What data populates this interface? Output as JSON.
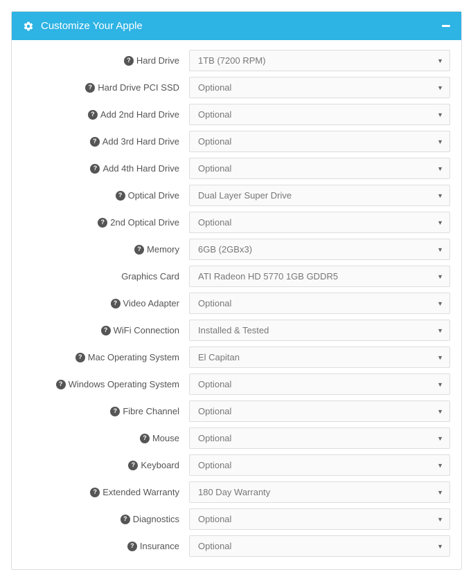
{
  "header": {
    "title": "Customize Your Apple"
  },
  "rows": [
    {
      "key": "hard-drive",
      "label": "Hard Drive",
      "value": "1TB (7200 RPM)",
      "help": true
    },
    {
      "key": "hard-drive-pci-ssd",
      "label": "Hard Drive PCI SSD",
      "value": "Optional",
      "help": true
    },
    {
      "key": "add-2nd-hard-drive",
      "label": "Add 2nd Hard Drive",
      "value": "Optional",
      "help": true
    },
    {
      "key": "add-3rd-hard-drive",
      "label": "Add 3rd Hard Drive",
      "value": "Optional",
      "help": true
    },
    {
      "key": "add-4th-hard-drive",
      "label": "Add 4th Hard Drive",
      "value": "Optional",
      "help": true
    },
    {
      "key": "optical-drive",
      "label": "Optical Drive",
      "value": "Dual Layer Super Drive",
      "help": true
    },
    {
      "key": "2nd-optical-drive",
      "label": "2nd Optical Drive",
      "value": "Optional",
      "help": true
    },
    {
      "key": "memory",
      "label": "Memory",
      "value": "6GB (2GBx3)",
      "help": true
    },
    {
      "key": "graphics-card",
      "label": "Graphics Card",
      "value": "ATI Radeon HD 5770 1GB GDDR5",
      "help": false
    },
    {
      "key": "video-adapter",
      "label": "Video Adapter",
      "value": "Optional",
      "help": true
    },
    {
      "key": "wifi-connection",
      "label": "WiFi Connection",
      "value": "Installed & Tested",
      "help": true
    },
    {
      "key": "mac-os",
      "label": "Mac Operating System",
      "value": "El Capitan",
      "help": true
    },
    {
      "key": "windows-os",
      "label": "Windows Operating System",
      "value": "Optional",
      "help": true
    },
    {
      "key": "fibre-channel",
      "label": "Fibre Channel",
      "value": "Optional",
      "help": true
    },
    {
      "key": "mouse",
      "label": "Mouse",
      "value": "Optional",
      "help": true
    },
    {
      "key": "keyboard",
      "label": "Keyboard",
      "value": "Optional",
      "help": true
    },
    {
      "key": "extended-warranty",
      "label": "Extended Warranty",
      "value": "180 Day Warranty",
      "help": true
    },
    {
      "key": "diagnostics",
      "label": "Diagnostics",
      "value": "Optional",
      "help": true
    },
    {
      "key": "insurance",
      "label": "Insurance",
      "value": "Optional",
      "help": true
    }
  ]
}
